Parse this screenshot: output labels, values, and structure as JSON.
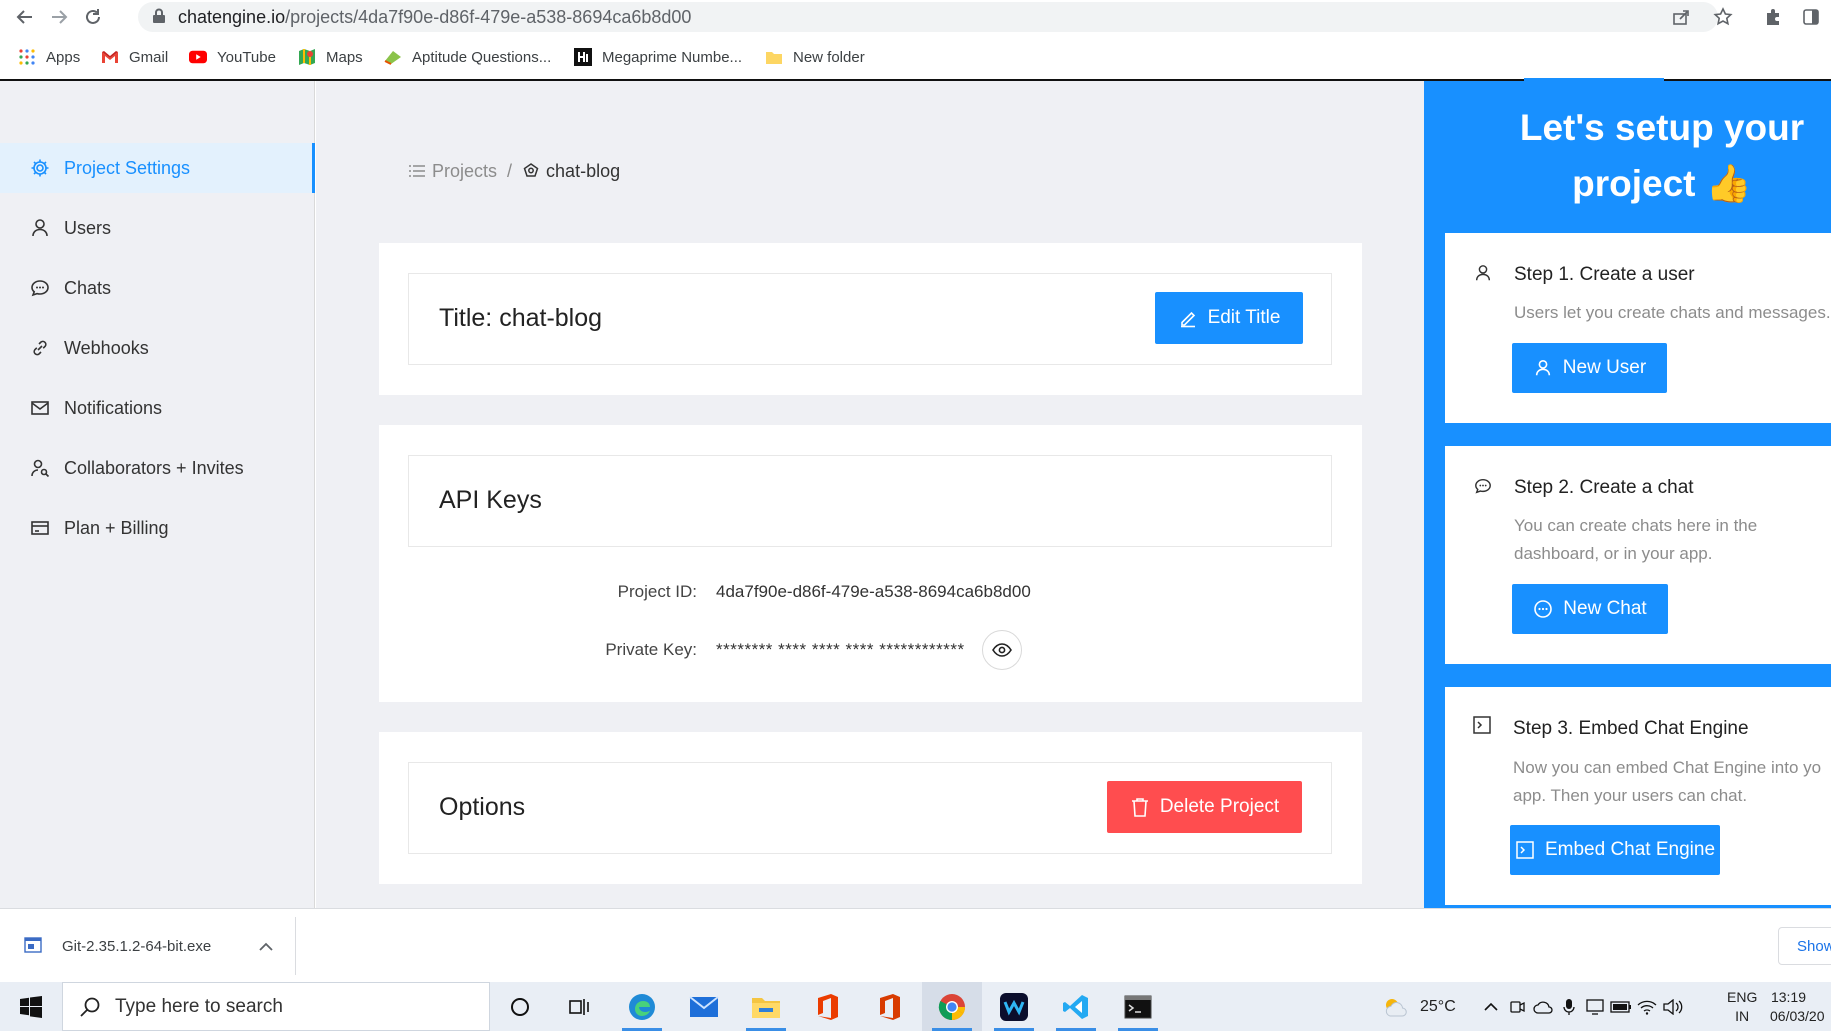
{
  "browser": {
    "url_host": "chatengine.io",
    "url_path": "/projects/4da7f90e-d86f-479e-a538-8694ca6b8d00",
    "bookmarks": [
      {
        "label": "Apps",
        "icon": "apps-grid-icon"
      },
      {
        "label": "Gmail",
        "icon": "gmail-icon"
      },
      {
        "label": "YouTube",
        "icon": "youtube-icon"
      },
      {
        "label": "Maps",
        "icon": "maps-icon"
      },
      {
        "label": "Aptitude Questions...",
        "icon": "aptitude-icon"
      },
      {
        "label": "Megaprime Numbe...",
        "icon": "hackerrank-icon"
      },
      {
        "label": "New folder",
        "icon": "folder-icon"
      }
    ]
  },
  "sidebar": {
    "items": [
      {
        "label": "Project Settings",
        "icon": "gear-icon",
        "active": true
      },
      {
        "label": "Users",
        "icon": "user-icon"
      },
      {
        "label": "Chats",
        "icon": "chat-icon"
      },
      {
        "label": "Webhooks",
        "icon": "webhook-icon"
      },
      {
        "label": "Notifications",
        "icon": "mail-icon"
      },
      {
        "label": "Collaborators + Invites",
        "icon": "collaborators-icon"
      },
      {
        "label": "Plan + Billing",
        "icon": "credit-card-icon"
      }
    ]
  },
  "breadcrumb": {
    "parent": "Projects",
    "current": "chat-blog"
  },
  "title_card": {
    "title": "Title: chat-blog",
    "edit_button": "Edit Title"
  },
  "api_keys_card": {
    "heading": "API Keys",
    "project_id_label": "Project ID:",
    "project_id_value": "4da7f90e-d86f-479e-a538-8694ca6b8d00",
    "private_key_label": "Private Key:",
    "private_key_value": "******** **** **** **** ************"
  },
  "options_card": {
    "heading": "Options",
    "delete_button": "Delete Project"
  },
  "setup_panel": {
    "heading_line1": "Let's setup your",
    "heading_line2": "project 👍",
    "steps": [
      {
        "title": "Step 1. Create a user",
        "description_lines": [
          "Users let you create chats and messages."
        ],
        "button": "New User",
        "icon": "user-icon"
      },
      {
        "title": "Step 2. Create a chat",
        "description_lines": [
          "You can create chats here in the",
          "dashboard, or in your app."
        ],
        "button": "New Chat",
        "icon": "chat-icon"
      },
      {
        "title": "Step 3. Embed Chat Engine",
        "description_lines": [
          "Now you can embed Chat Engine into yo",
          "app. Then your users can chat."
        ],
        "button": "Embed Chat Engine",
        "icon": "code-terminal-icon"
      }
    ]
  },
  "download_bar": {
    "file_name": "Git-2.35.1.2-64-bit.exe",
    "show_all": "Show"
  },
  "taskbar": {
    "search_placeholder": "Type here to search",
    "weather": "25°C",
    "language_line1": "ENG",
    "language_line2": "IN",
    "time": "13:19",
    "date": "06/03/20"
  },
  "colors": {
    "primary": "#1890ff",
    "danger": "#ff4d4f",
    "sidebar_bg": "#eff0f4"
  }
}
